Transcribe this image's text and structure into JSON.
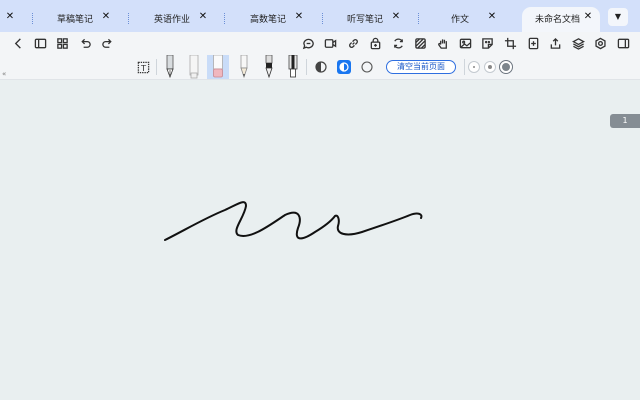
{
  "tabs": [
    {
      "label": "",
      "close": "✕"
    },
    {
      "label": "草稿笔记",
      "close": "✕"
    },
    {
      "label": "英语作业",
      "close": "✕"
    },
    {
      "label": "高数笔记",
      "close": "✕"
    },
    {
      "label": "听写笔记",
      "close": "✕"
    },
    {
      "label": "作文",
      "close": "✕"
    },
    {
      "label": "未命名文档",
      "close": "✕",
      "active": true
    }
  ],
  "tab_dropdown": "▼",
  "toolbar": {
    "left_icons": [
      "back-icon",
      "sidebar-icon",
      "grid-icon",
      "undo-icon",
      "redo-icon"
    ],
    "right_icons": [
      "comment-icon",
      "video-icon",
      "link-icon",
      "lock-add-icon",
      "refresh-icon",
      "pattern-icon",
      "hand-icon",
      "image-icon",
      "sticker-icon",
      "crop-icon",
      "insert-page-icon",
      "share-icon",
      "layers-icon",
      "settings-icon",
      "panel-icon"
    ]
  },
  "pen_toolbar": {
    "text_tool": "T",
    "pens": [
      "fountain-pen",
      "highlighter",
      "eraser",
      "pencil",
      "ballpoint-pen",
      "marker"
    ],
    "selected_pen": "eraser",
    "clear_page_label": "清空当前页面",
    "stroke_sizes": [
      "small",
      "medium",
      "large"
    ],
    "selected_size": "large"
  },
  "page_number": "1",
  "colors": {
    "tabbar_bg": "#d3e0fa",
    "toolbar_bg": "#f3f5f7",
    "canvas_bg": "#e9eff0",
    "accent": "#1976f0",
    "ink": "#111111"
  }
}
